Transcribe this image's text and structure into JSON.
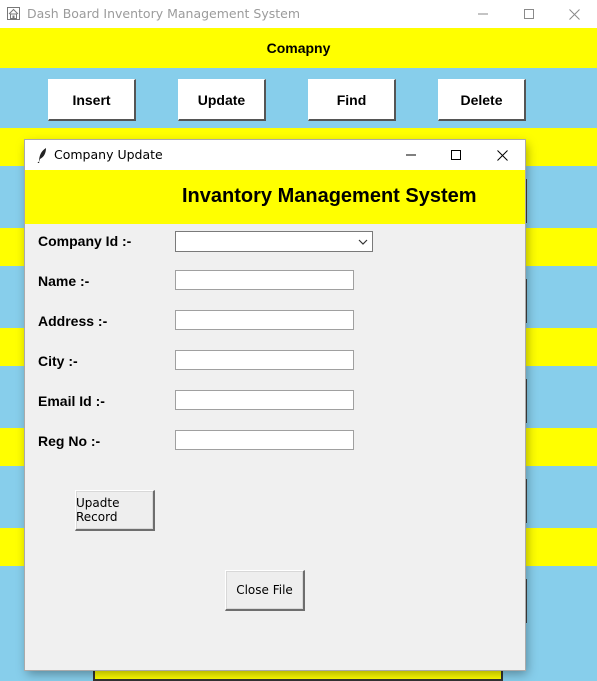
{
  "main_window": {
    "title": "Dash Board Inventory Management System",
    "header_label": "Comapny",
    "buttons": {
      "insert": "Insert",
      "update": "Update",
      "find": "Find",
      "delete": "Delete"
    }
  },
  "dialog": {
    "title": "Company Update",
    "heading": "Invantory Management System",
    "fields": {
      "company_id": {
        "label": "Company Id :-",
        "value": ""
      },
      "name": {
        "label": "Name :-",
        "value": ""
      },
      "address": {
        "label": "Address :-",
        "value": ""
      },
      "city": {
        "label": "City :-",
        "value": ""
      },
      "email_id": {
        "label": "Email Id :-",
        "value": ""
      },
      "reg_no": {
        "label": "Reg No :-",
        "value": ""
      }
    },
    "buttons": {
      "update_record": "Upadte Record",
      "close_file": "Close File"
    }
  },
  "colors": {
    "header_yellow": "#ffff00",
    "background_blue": "#87ceeb",
    "dialog_gray": "#f0f0f0"
  },
  "icons": {
    "main_app": "house-icon",
    "dialog_app": "feather-icon",
    "minimize": "minimize-icon",
    "maximize": "maximize-icon",
    "close": "close-icon",
    "dropdown": "chevron-down-icon"
  }
}
